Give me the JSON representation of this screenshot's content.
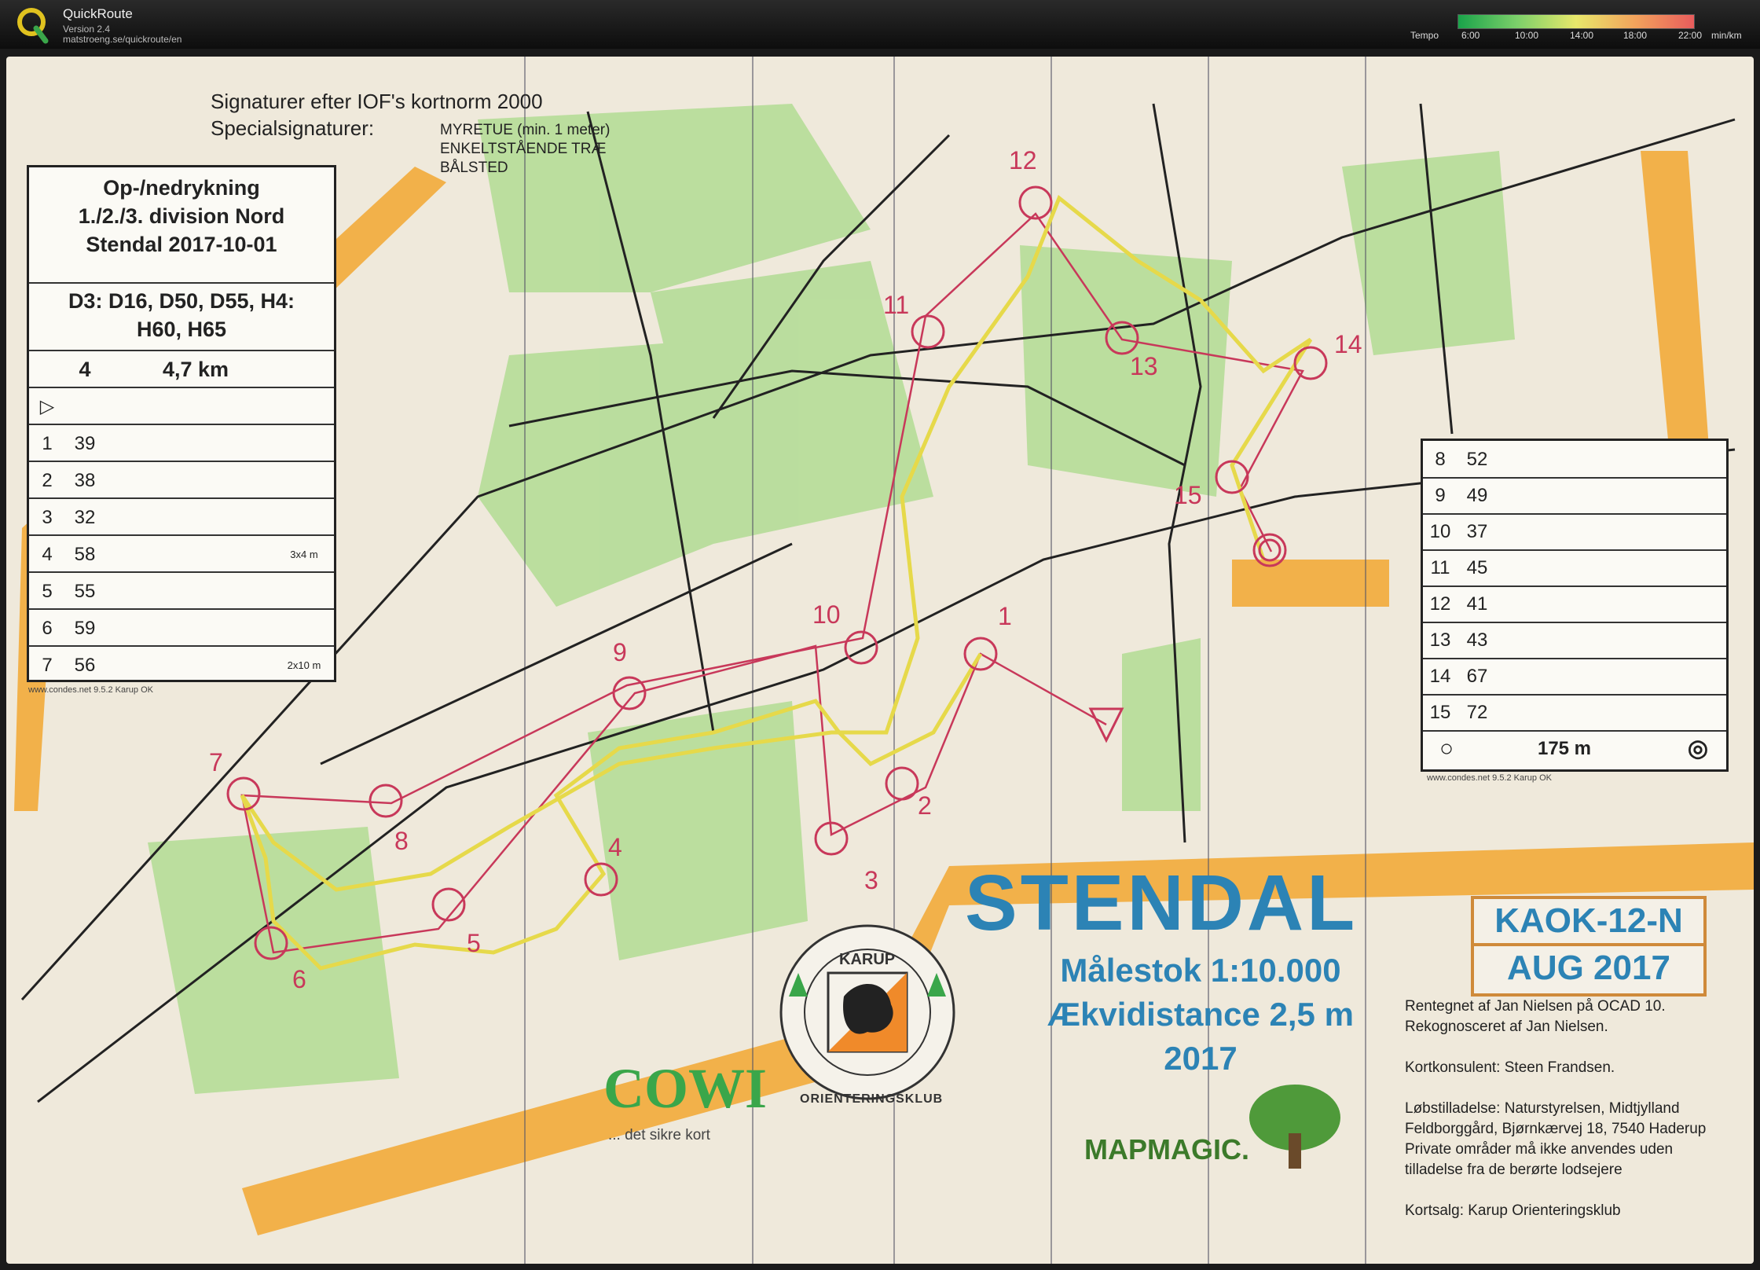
{
  "app": {
    "title": "QuickRoute",
    "version": "Version 2.4",
    "url": "matstroeng.se/quickroute/en"
  },
  "tempo": {
    "label": "Tempo",
    "ticks": [
      "6:00",
      "10:00",
      "14:00",
      "18:00",
      "22:00"
    ],
    "unit": "min/km"
  },
  "legend": {
    "line1": "Signaturer efter IOF's kortnorm 2000",
    "line2": "Specialsignaturer:",
    "specials": [
      "MYRETUE (min. 1 meter)",
      "ENKELTSTÅENDE TRÆ",
      "BÅLSTED"
    ]
  },
  "left_card": {
    "title1": "Op-/nedrykning",
    "title2": "1./2./3. division Nord",
    "title3": "Stendal 2017-10-01",
    "classes1": "D3: D16, D50, D55, H4:",
    "classes2": "H60, H65",
    "course": "4",
    "length": "4,7 km",
    "rows": [
      {
        "n": "1",
        "code": "39"
      },
      {
        "n": "2",
        "code": "38"
      },
      {
        "n": "3",
        "code": "32"
      },
      {
        "n": "4",
        "code": "58"
      },
      {
        "n": "5",
        "code": "55"
      },
      {
        "n": "6",
        "code": "59"
      },
      {
        "n": "7",
        "code": "56"
      }
    ],
    "dim1": "3x4 m",
    "dim2": "2x10 m",
    "footer": "www.condes.net 9.5.2 Karup OK"
  },
  "right_card": {
    "rows": [
      {
        "n": "8",
        "code": "52"
      },
      {
        "n": "9",
        "code": "49"
      },
      {
        "n": "10",
        "code": "37"
      },
      {
        "n": "11",
        "code": "45"
      },
      {
        "n": "12",
        "code": "41"
      },
      {
        "n": "13",
        "code": "43"
      },
      {
        "n": "14",
        "code": "67"
      },
      {
        "n": "15",
        "code": "72"
      }
    ],
    "finish": "175 m",
    "footer": "www.condes.net 9.5.2 Karup OK"
  },
  "title": "STENDAL",
  "scale_line": "Målestok 1:10.000",
  "contour_line": "Ækvidistance 2,5 m",
  "year": "2017",
  "kaok": "KAOK-12-N",
  "kaok_date": "AUG 2017",
  "credits": [
    "Rentegnet af Jan Nielsen på OCAD 10.",
    "Rekognosceret af Jan Nielsen.",
    "",
    "Kortkonsulent: Steen Frandsen.",
    "",
    "Løbstilladelse: Naturstyrelsen, Midtjylland",
    "Feldborggård, Bjørnkærvej 18, 7540 Haderup",
    "Private områder må ikke anvendes uden",
    "tilladelse fra de berørte lodsejere",
    "",
    "Kortsalg: Karup Orienteringsklub"
  ],
  "club": {
    "top": "KARUP",
    "bottom": "ORIENTERINGSKLUB"
  },
  "cowi": "COWI",
  "cowi_sub": "... det sikre kort",
  "mapmagic": "MAPMAGIC.",
  "controls": [
    "1",
    "2",
    "3",
    "4",
    "5",
    "6",
    "7",
    "8",
    "9",
    "10",
    "11",
    "12",
    "13",
    "14",
    "15"
  ],
  "colors": {
    "course": "#c8385a",
    "route": "#e6d94a",
    "forest": "#9fd37d",
    "road_orange": "#f2b14a",
    "title_blue": "#2c83b5"
  }
}
